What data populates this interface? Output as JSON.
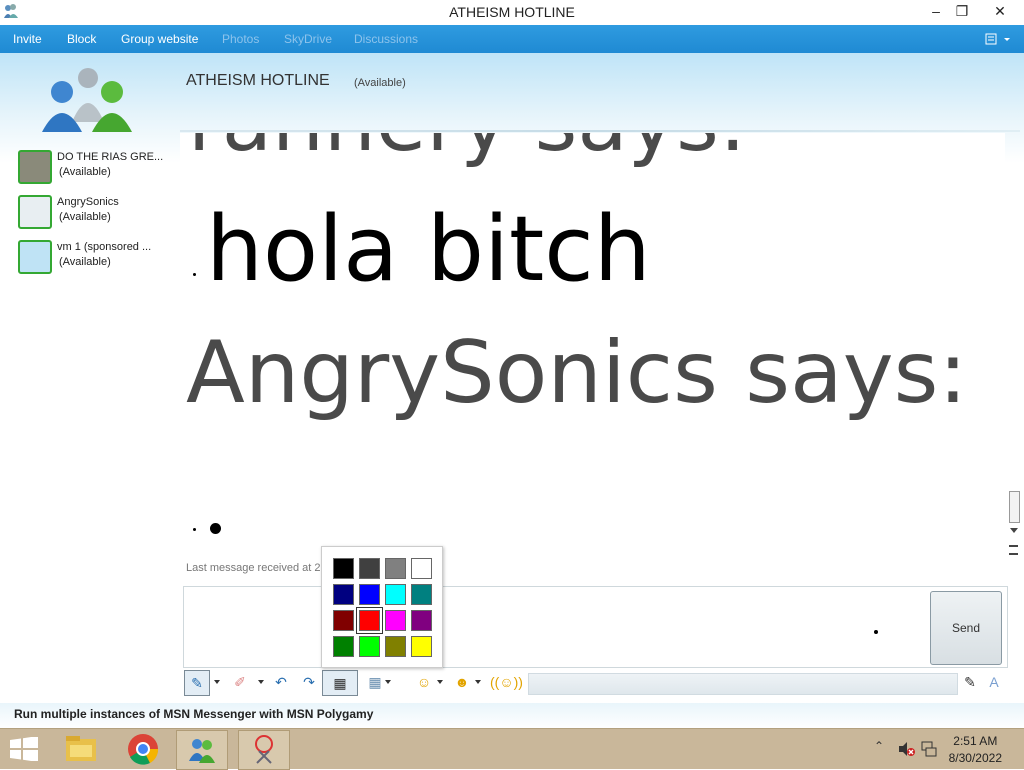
{
  "window": {
    "title": "ATHEISM HOTLINE",
    "controls": [
      "–",
      "❐",
      "✕"
    ]
  },
  "menu": {
    "items": [
      {
        "label": "Invite",
        "enabled": true
      },
      {
        "label": "Block",
        "enabled": true
      },
      {
        "label": "Group website",
        "enabled": true
      },
      {
        "label": "Photos",
        "enabled": false
      },
      {
        "label": "SkyDrive",
        "enabled": false
      },
      {
        "label": "Discussions",
        "enabled": false
      }
    ]
  },
  "conversation": {
    "name": "ATHEISM HOTLINE",
    "status": "(Available)"
  },
  "contacts": [
    {
      "name": "DO THE RIAS GRE...",
      "status": "(Available)"
    },
    {
      "name": "AngrySonics",
      "status": "(Available)"
    },
    {
      "name": "vm 1 (sponsored ...",
      "status": "(Available)"
    }
  ],
  "chat": {
    "partial_header": "rannery says:",
    "message": "hola bitch",
    "sender_line": "AngrySonics says:",
    "last_message": "Last message received at 2"
  },
  "input": {
    "send_label": "Send"
  },
  "palette": {
    "colors": [
      "#000000",
      "#404040",
      "#808080",
      "#ffffff",
      "#000080",
      "#0000ff",
      "#00ffff",
      "#008080",
      "#800000",
      "#ff0000",
      "#ff00ff",
      "#800080",
      "#008000",
      "#00ff00",
      "#808000",
      "#ffff00"
    ],
    "selected": "#ff0000"
  },
  "ad": {
    "text": "Run multiple instances of MSN Messenger with MSN Polygamy"
  },
  "taskbar": {
    "time": "2:51 AM",
    "date": "8/30/2022"
  }
}
